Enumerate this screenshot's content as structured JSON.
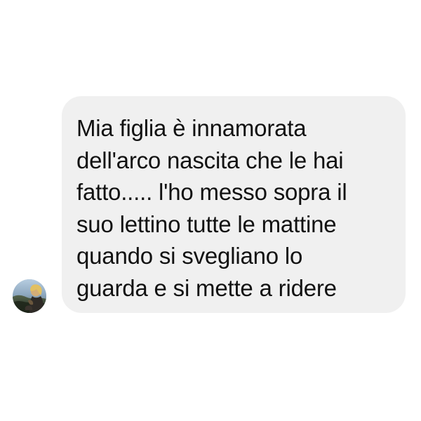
{
  "conversation": {
    "message": {
      "lines": [
        "Mia figlia è innamorata",
        "dell'arco nascita che le hai",
        "fatto..... l'ho messo sopra il",
        "suo lettino tutte le mattine",
        "quando si svegliano lo",
        "guarda e si mette a ridere"
      ]
    },
    "colors": {
      "bubble_background": "#f0f0f0",
      "text": "#111111",
      "page_background": "#ffffff"
    },
    "icons": {
      "avatar": "profile-photo-avatar"
    }
  }
}
